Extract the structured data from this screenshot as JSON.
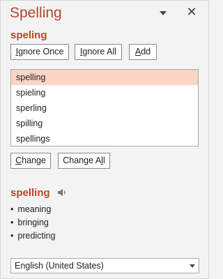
{
  "pane": {
    "title": "Spelling"
  },
  "misspelled_word": "speling",
  "actions": {
    "ignore_once": {
      "pre": "",
      "acc": "I",
      "post": "gnore Once"
    },
    "ignore_all": {
      "pre": "",
      "acc": "I",
      "post": "gnore All"
    },
    "add": {
      "pre": "",
      "acc": "A",
      "post": "dd"
    },
    "change": {
      "pre": "",
      "acc": "C",
      "post": "hange"
    },
    "change_all": {
      "pre": "Change A",
      "acc": "l",
      "post": "l"
    }
  },
  "suggestions": {
    "selected_index": 0,
    "items": [
      "spelling",
      "spieling",
      "sperling",
      "spilling",
      "spellings"
    ]
  },
  "definition": {
    "word": "spelling",
    "synonyms": [
      "meaning",
      "bringing",
      "predicting"
    ]
  },
  "language": {
    "selected": "English (United States)"
  },
  "colors": {
    "accent": "#b7472a",
    "selection": "#fcd4c4"
  }
}
